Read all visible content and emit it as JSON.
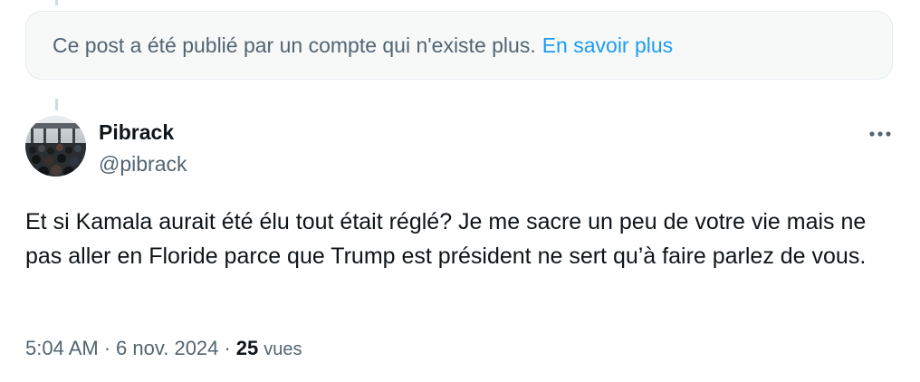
{
  "deleted_notice": {
    "message": "Ce post a été publié par un compte qui n'existe plus.",
    "link_label": "En savoir plus"
  },
  "post": {
    "author": {
      "display_name": "Pibrack",
      "handle": "@pibrack"
    },
    "more_icon": "more-horizontal-icon",
    "text": "Et si Kamala aurait été élu tout était réglé? Je me sacre un peu de votre vie mais ne pas aller en Floride parce que Trump est président ne sert qu’à faire parlez de vous.",
    "time": "5:04 AM",
    "separator": "·",
    "date": "6 nov. 2024",
    "views_count": "25",
    "views_label": "vues"
  },
  "colors": {
    "text_primary": "#0f1419",
    "text_secondary": "#536471",
    "link": "#1d9bf0",
    "notice_background": "#f7f9f9",
    "thread_line": "#cfd9de"
  }
}
